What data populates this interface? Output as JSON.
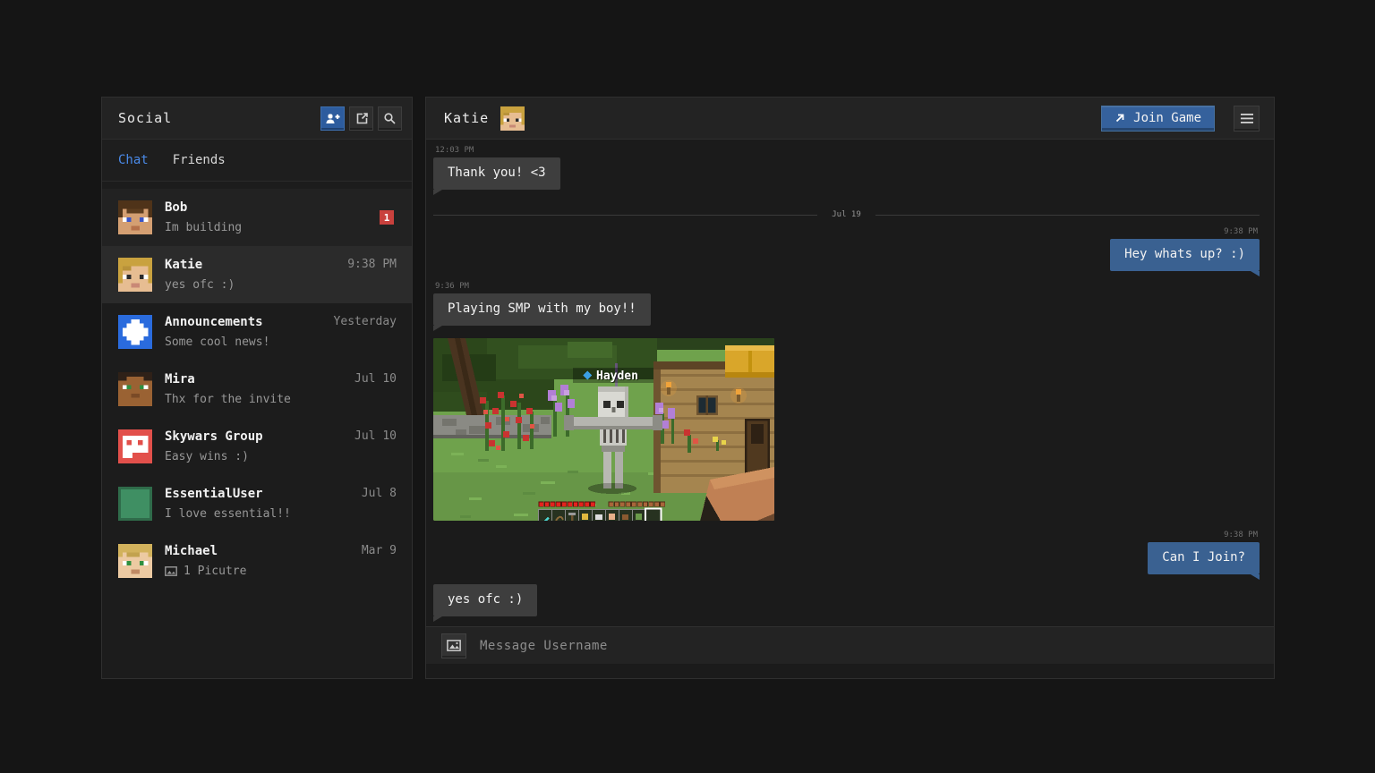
{
  "colors": {
    "accent_blue": "#4a8ae8",
    "bubble_sent_blue": "#3a6191",
    "bubble_received_grey": "#3e3e3e",
    "join_button_blue": "#35619c",
    "unread_badge_red": "#c9413d",
    "announcements_blue": "#2a6bdd",
    "skywars_red": "#e2504b",
    "essential_green": "#3f8f63"
  },
  "sidebar": {
    "title": "Social",
    "toolbar": {
      "icons": [
        "add-friend-icon",
        "create-group-icon",
        "search-icon"
      ]
    },
    "tabs": [
      {
        "label": "Chat",
        "active": true
      },
      {
        "label": "Friends",
        "active": false
      }
    ],
    "conversations": [
      {
        "name": "Bob",
        "preview": "Im building",
        "unread_badge": "1"
      },
      {
        "name": "Katie",
        "preview": "yes ofc :)",
        "time": "9:38 PM",
        "selected": true
      },
      {
        "name": "Announcements",
        "preview": "Some cool news!",
        "time": "Yesterday"
      },
      {
        "name": "Mira",
        "preview": "Thx for the invite",
        "time": "Jul 10"
      },
      {
        "name": "Skywars Group",
        "preview": "Easy wins :)",
        "time": "Jul 10"
      },
      {
        "name": "EssentialUser",
        "preview": "I love essential!!",
        "time": "Jul 8"
      },
      {
        "name": "Michael",
        "preview": "1 Picutre",
        "time": "Mar 9",
        "preview_icon": "picture-icon"
      }
    ]
  },
  "chat": {
    "title": "Katie",
    "join_game_label": "Join Game",
    "messages": [
      {
        "type": "received",
        "time": "12:03 PM",
        "text": "Thank you! <3"
      },
      {
        "type": "date_divider",
        "label": "Jul 19"
      },
      {
        "type": "sent",
        "time": "9:38 PM",
        "text": "Hey whats up? :)"
      },
      {
        "type": "received",
        "time": "9:36 PM",
        "text": "Playing SMP with my boy!!"
      },
      {
        "type": "image",
        "description": "Minecraft screenshot: skeleton in a flower garden in front of a wooden house",
        "nametag": "Hayden"
      },
      {
        "type": "sent",
        "time": "9:38 PM",
        "text": "Can I Join?"
      },
      {
        "type": "received",
        "text": "yes ofc :)"
      }
    ],
    "input_placeholder": "Message Username"
  }
}
